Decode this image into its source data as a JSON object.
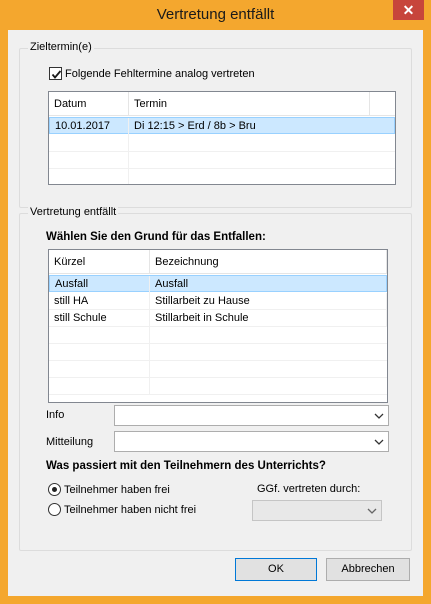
{
  "window": {
    "title": "Vertretung entfällt",
    "close_glyph": "✕"
  },
  "zieltermin": {
    "legend": "Zieltermin(e)",
    "checkbox_label": "Folgende Fehltermine analog vertreten",
    "checkbox_checked": true,
    "columns": [
      "Datum",
      "Termin"
    ],
    "rows": [
      {
        "datum": "10.01.2017",
        "termin": "Di 12:15 > Erd / 8b > Bru",
        "selected": true
      }
    ]
  },
  "vertretung": {
    "legend": "Vertretung entfällt",
    "prompt": "Wählen Sie den Grund für das Entfallen:",
    "columns": [
      "Kürzel",
      "Bezeichnung"
    ],
    "rows": [
      {
        "kuerzel": "Ausfall",
        "bezeichnung": "Ausfall",
        "selected": true
      },
      {
        "kuerzel": "still HA",
        "bezeichnung": "Stillarbeit zu Hause",
        "selected": false
      },
      {
        "kuerzel": "still Schule",
        "bezeichnung": "Stillarbeit in Schule",
        "selected": false
      }
    ],
    "info_label": "Info",
    "info_value": "",
    "mitteilung_label": "Mitteilung",
    "mitteilung_value": "",
    "question": "Was passiert mit den Teilnehmern des Unterrichts?",
    "radio_frei": "Teilnehmer haben frei",
    "radio_nicht_frei": "Teilnehmer haben nicht frei",
    "selected_radio": "frei",
    "vertreten_label": "GGf. vertreten durch:",
    "vertreten_value": ""
  },
  "buttons": {
    "ok": "OK",
    "cancel": "Abbrechen"
  }
}
